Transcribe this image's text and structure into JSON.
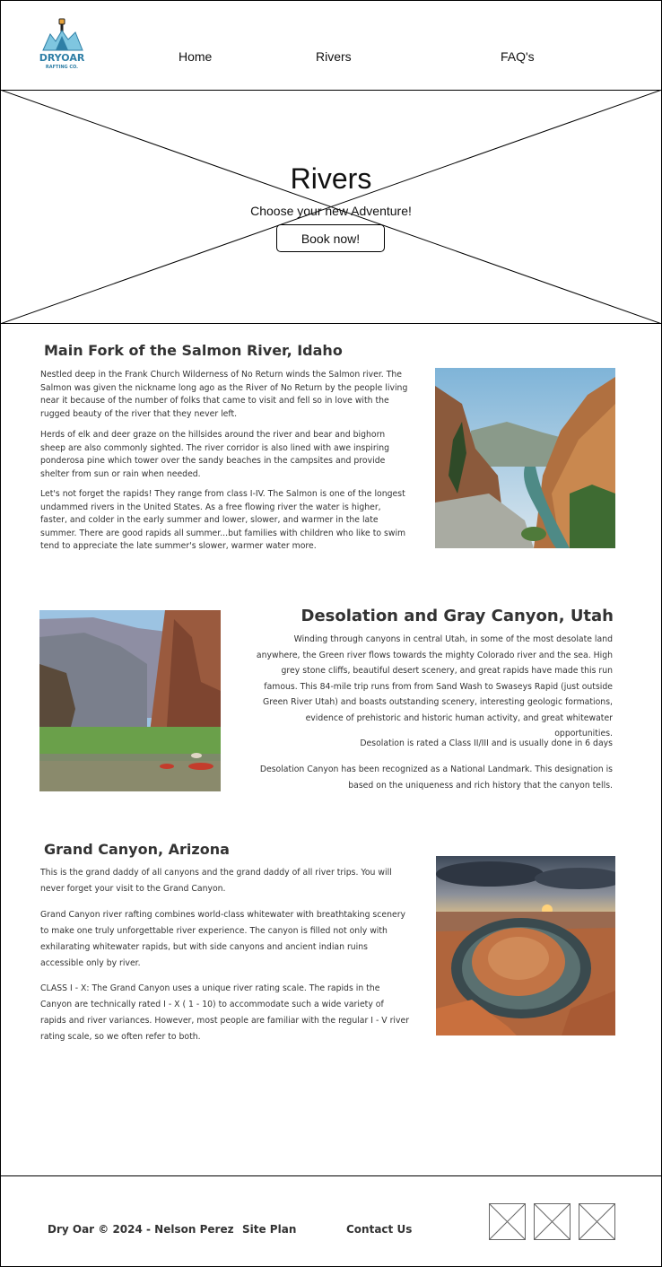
{
  "logo": {
    "line1": "DRYOAR",
    "line2": "RAFTING CO."
  },
  "nav": {
    "home": "Home",
    "rivers": "Rivers",
    "faq": "FAQ's"
  },
  "hero": {
    "title": "Rivers",
    "subtitle": "Choose your new Adventure!",
    "button": "Book now!"
  },
  "sections": [
    {
      "title": "Main Fork of the Salmon River, Idaho",
      "paragraphs": [
        "Nestled deep in the Frank Church Wilderness of No Return winds the Salmon river. The Salmon was given the nickname long ago as the River of No Return by the people living near it because of the number of folks that came to visit and fell so in love with the rugged beauty of the river that they never left.",
        "Herds of elk and deer graze on the hillsides around the river and bear and bighorn sheep are also commonly sighted. The river corridor is also lined with awe inspiring ponderosa pine which tower over the sandy beaches in the campsites and provide shelter from sun or rain when needed.",
        "Let's not forget the rapids! They range from class I-IV. The Salmon is one of the longest undammed rivers in the United States. As a free flowing river the water is higher, faster, and colder in the early summer and lower, slower, and warmer in the late summer. There are good rapids all summer...but families with children who like to swim tend to appreciate the late summer's slower, warmer water more."
      ]
    },
    {
      "title": "Desolation and Gray Canyon, Utah",
      "paragraphs": [
        "Winding through canyons in central Utah, in some of the most desolate land anywhere, the Green river flows towards the mighty Colorado river and the sea. High grey stone cliffs, beautiful desert scenery, and great rapids have made this run famous. This 84-mile trip runs from from Sand Wash to Swaseys Rapid (just outside Green River Utah) and boasts outstanding scenery, interesting geologic formations, evidence of prehistoric and historic human activity, and great whitewater opportunities.",
        "Desolation is rated a Class II/III and is usually done in 6 days",
        "Desolation Canyon has been recognized as a National Landmark.  This designation is based on the uniqueness and rich history that the canyon tells."
      ]
    },
    {
      "title": "Grand Canyon, Arizona",
      "paragraphs": [
        "This is the grand daddy of all canyons and the grand daddy of all river trips. You will never forget your visit to the Grand Canyon.",
        "Grand Canyon river rafting combines world-class whitewater with breathtaking scenery to make one truly unforgettable river experience. The canyon is filled not only with exhilarating whitewater rapids, but with side canyons and ancient indian ruins accessible only by river.",
        "CLASS I - X: The Grand Canyon uses a unique river rating scale. The rapids in the Canyon are technically rated I - X ( 1 - 10) to accommodate such a wide variety of rapids and river variances. However, most people are familiar with the regular I - V river rating scale, so we often refer to both."
      ]
    }
  ],
  "footer": {
    "copyright": "Dry Oar © 2024 - Nelson Perez",
    "site_plan": "Site Plan",
    "contact": "Contact Us"
  },
  "colors": {
    "logo_blue": "#2f7fa6",
    "logo_light": "#7fc6e0",
    "border": "#000000",
    "text": "#333333"
  }
}
